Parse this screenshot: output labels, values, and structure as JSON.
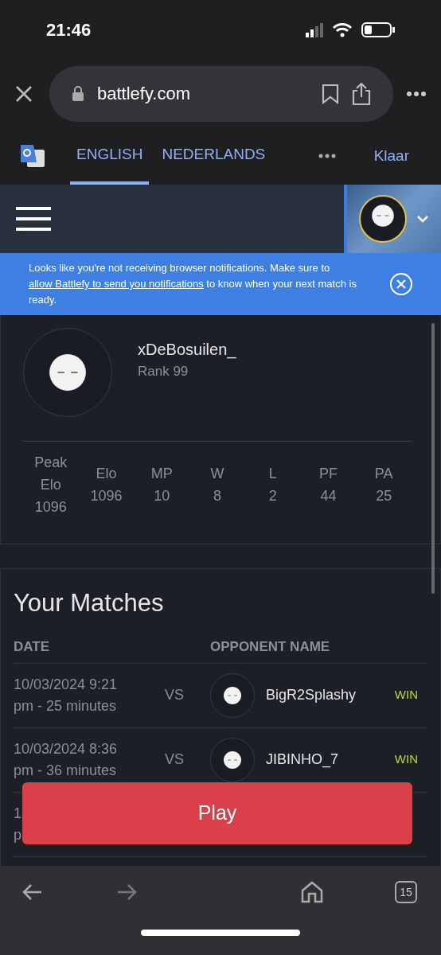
{
  "status_bar": {
    "time": "21:46"
  },
  "browser": {
    "url": "battlefy.com"
  },
  "translate_bar": {
    "tabs": [
      {
        "label": "ENGLISH",
        "selected": true
      },
      {
        "label": "NEDERLANDS",
        "selected": false
      }
    ],
    "done": "Klaar"
  },
  "banner": {
    "text_before": "Looks like you're not receiving browser notifications. Make sure to ",
    "link": "allow Battlefy to send you notifications",
    "text_after": " to know when your next match is ready."
  },
  "profile": {
    "name": "xDeBosuilen_",
    "rank": "Rank 99",
    "stats": [
      {
        "label": "Peak Elo",
        "value": "1096"
      },
      {
        "label": "Elo",
        "value": "1096"
      },
      {
        "label": "MP",
        "value": "10"
      },
      {
        "label": "W",
        "value": "8"
      },
      {
        "label": "L",
        "value": "2"
      },
      {
        "label": "PF",
        "value": "44"
      },
      {
        "label": "PA",
        "value": "25"
      }
    ]
  },
  "matches": {
    "title": "Your Matches",
    "columns": [
      "DATE",
      "OPPONENT NAME"
    ],
    "rows": [
      {
        "date_line1": "10/03/2024 9:21",
        "date_line2": "pm - 25 minutes",
        "vs": "VS",
        "opponent": "BigR2Splashy",
        "result": "WIN"
      },
      {
        "date_line1": "10/03/2024 8:36",
        "date_line2": "pm - 36 minutes",
        "vs": "VS",
        "opponent": "JIBINHO_7",
        "result": "WIN"
      },
      {
        "date_line1": "1",
        "date_line2": "p"
      }
    ]
  },
  "play_button": "Play",
  "tab_count": "15"
}
